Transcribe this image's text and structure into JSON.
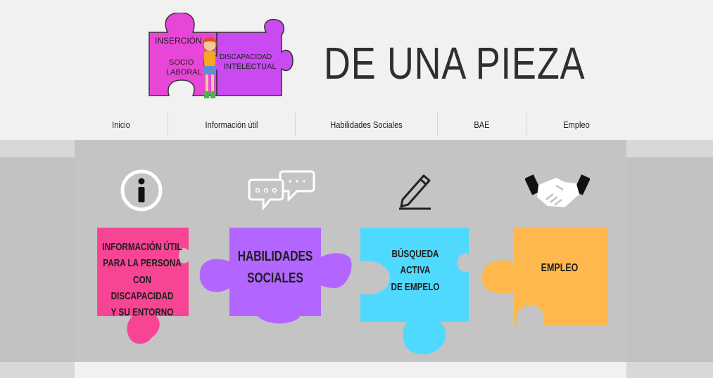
{
  "header": {
    "title": "DE UNA PIEZA",
    "logo": {
      "text_insercion": "INSERCIÓN",
      "text_socio": "SOCIO",
      "text_laboral": "LABORAL",
      "text_discapacidad": "DISCAPACIDAD",
      "text_intelectual": "INTELECTUAL"
    }
  },
  "nav": {
    "items": [
      {
        "label": "Inicio"
      },
      {
        "label": "Información útil"
      },
      {
        "label": "Habilidades Sociales"
      },
      {
        "label": "BAE"
      },
      {
        "label": "Empleo"
      }
    ]
  },
  "cards": [
    {
      "icon": "info-icon",
      "label": "INFORMACIÓN ÚTIL\nPARA LA PERSONA\nCON DISCAPACIDAD\nY SU ENTORNO",
      "color": "#f74594"
    },
    {
      "icon": "chat-bubbles-icon",
      "label": "HABILIDADES\nSOCIALES",
      "color": "#b266ff"
    },
    {
      "icon": "pencil-icon",
      "label": "BÚSQUEDA\nACTIVA\nDE EMPELO",
      "color": "#4fd9ff"
    },
    {
      "icon": "handshake-icon",
      "label": "EMPLEO",
      "color": "#ffb84d"
    }
  ],
  "colors": {
    "background": "#f1f1f1",
    "panel": "#c4c4c4",
    "logo_magenta": "#e846d6",
    "logo_purple": "#c84af0"
  }
}
